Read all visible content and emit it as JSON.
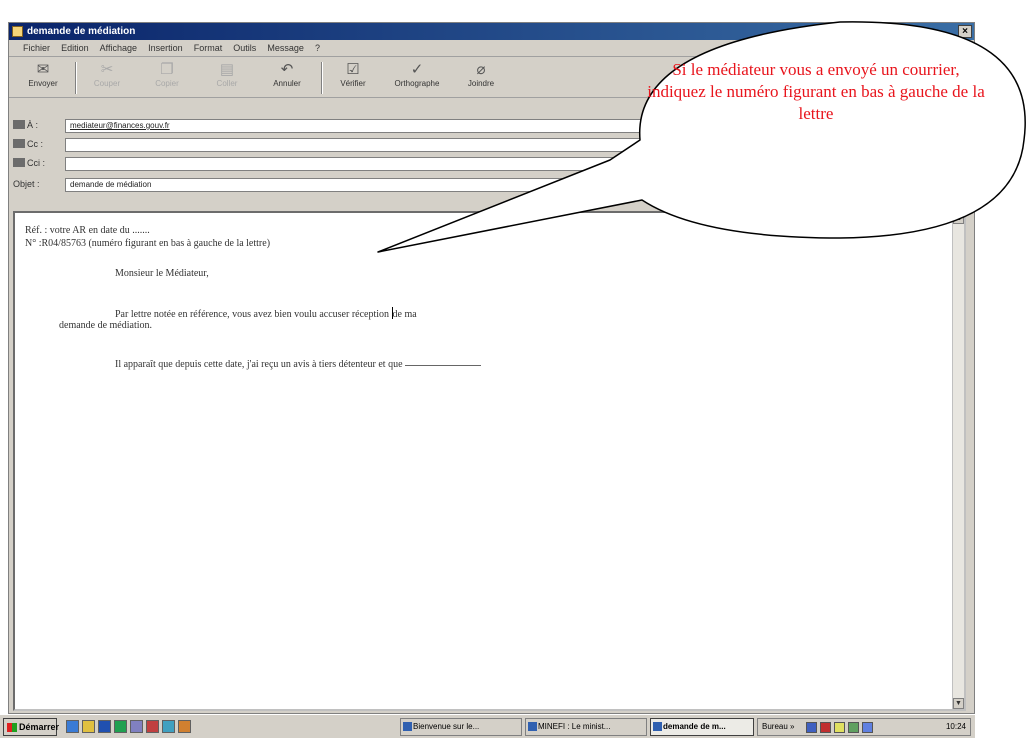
{
  "window": {
    "title": "demande de médiation"
  },
  "menu": [
    "Fichier",
    "Edition",
    "Affichage",
    "Insertion",
    "Format",
    "Outils",
    "Message",
    "?"
  ],
  "toolbar": [
    {
      "label": "Envoyer",
      "icon": "send-icon",
      "enabled": true
    },
    {
      "label": "Couper",
      "icon": "cut-icon",
      "enabled": false
    },
    {
      "label": "Copier",
      "icon": "copy-icon",
      "enabled": false
    },
    {
      "label": "Coller",
      "icon": "paste-icon",
      "enabled": false
    },
    {
      "label": "Annuler",
      "icon": "undo-icon",
      "enabled": true
    },
    {
      "label": "Vérifier",
      "icon": "check-names-icon",
      "enabled": true
    },
    {
      "label": "Orthographe",
      "icon": "spelling-icon",
      "enabled": true
    },
    {
      "label": "Joindre",
      "icon": "attach-icon",
      "enabled": true
    }
  ],
  "headers": {
    "to": {
      "label": "À :",
      "value": "mediateur@finances.gouv.fr"
    },
    "cc": {
      "label": "Cc :",
      "value": ""
    },
    "bcc": {
      "label": "Cci :",
      "value": ""
    },
    "subject": {
      "label": "Objet :",
      "value": "demande de médiation"
    }
  },
  "body": {
    "line1": "Réf. : votre AR en date du .......",
    "line2": "N° :R04/85763  (numéro figurant en bas à gauche de la lettre)",
    "line3": "Monsieur le Médiateur,",
    "line4a": "Par lettre notée en référence, vous avez bien voulu accuser réception",
    "line4b": "de ma",
    "line5": "demande de médiation.",
    "line6": "Il apparaît que depuis cette date, j'ai reçu un avis à tiers détenteur et que"
  },
  "callout": {
    "text": "Si le médiateur vous a envoyé un courrier, indiquez le numéro figurant en bas à gauche de la lettre",
    "color": "#e8141c"
  },
  "taskbar": {
    "start_label": "Démarrer",
    "tasks": [
      {
        "label": "Bienvenue sur le..."
      },
      {
        "label": "MINEFI : Le minist..."
      },
      {
        "label": "demande de m...",
        "active": true
      }
    ],
    "tray_label": "Bureau »",
    "clock": "10:24"
  }
}
